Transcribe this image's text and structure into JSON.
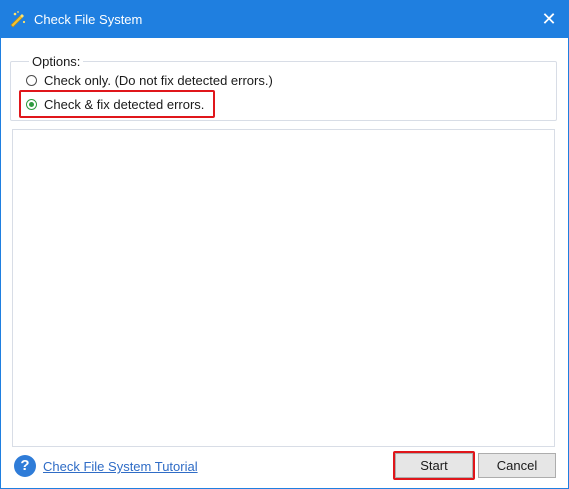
{
  "window": {
    "title": "Check File System",
    "close_glyph": "✕",
    "accent_color": "#1f7fe0",
    "app_icon": "wand-icon"
  },
  "options": {
    "legend": "Options:",
    "items": [
      {
        "label": "Check only. (Do not fix detected errors.)",
        "checked": false
      },
      {
        "label": "Check & fix detected errors.",
        "checked": true
      }
    ],
    "highlight_color": "#e0161b"
  },
  "footer": {
    "help_glyph": "?",
    "tutorial_link": "Check File System Tutorial",
    "start_label": "Start",
    "cancel_label": "Cancel"
  }
}
